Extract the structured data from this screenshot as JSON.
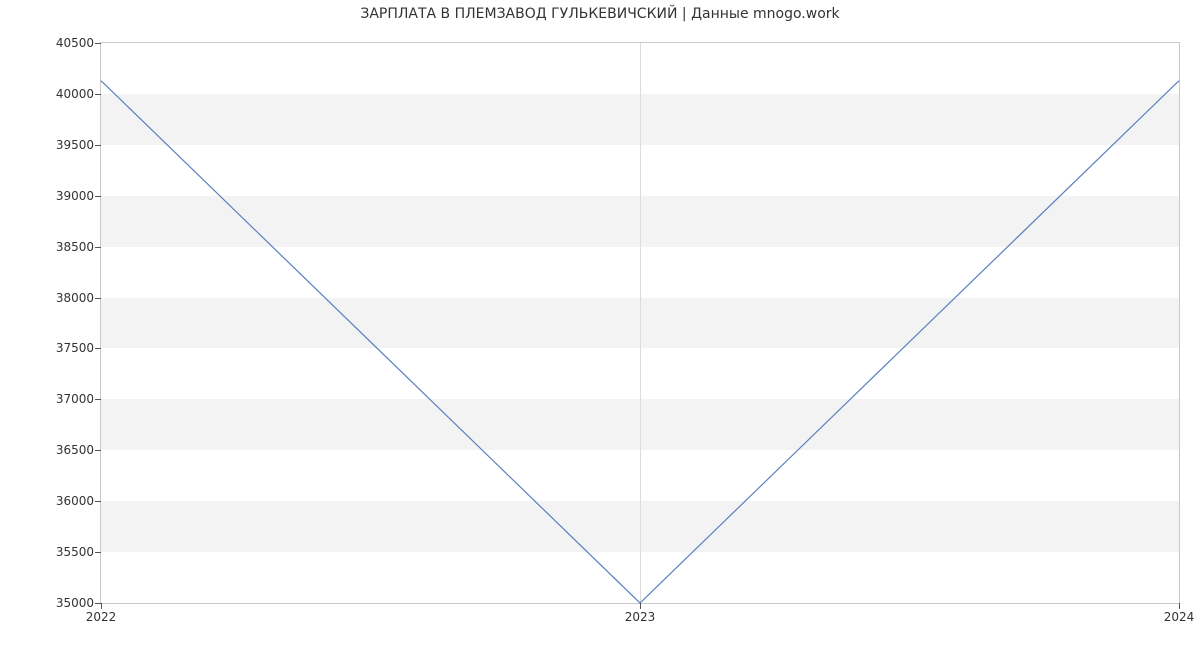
{
  "chart_data": {
    "type": "line",
    "title": "ЗАРПЛАТА В  ПЛЕМЗАВОД ГУЛЬКЕВИЧСКИЙ | Данные mnogo.work",
    "x": [
      2022,
      2023,
      2024
    ],
    "values": [
      40130,
      35000,
      40130
    ],
    "xlabel": "",
    "ylabel": "",
    "xlim": [
      2022,
      2024
    ],
    "ylim": [
      35000,
      40500
    ],
    "y_ticks": [
      35000,
      35500,
      36000,
      36500,
      37000,
      37500,
      38000,
      38500,
      39000,
      39500,
      40000,
      40500
    ],
    "x_ticks": [
      2022,
      2023,
      2024
    ],
    "line_color": "#5a7fbf"
  }
}
